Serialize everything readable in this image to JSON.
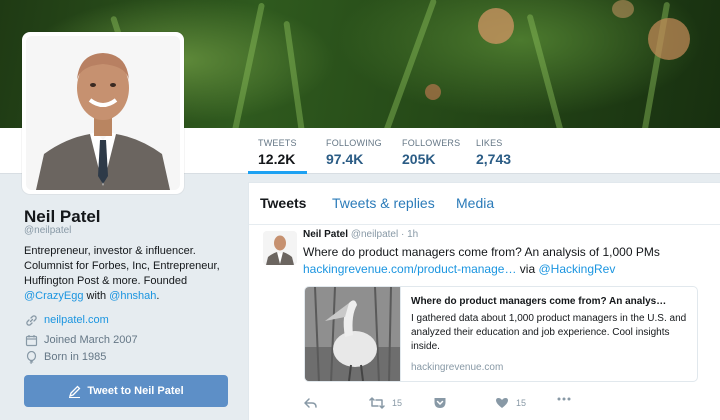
{
  "profile": {
    "name": "Neil Patel",
    "handle": "@neilpatel",
    "bio_text": "Entrepreneur, investor & influencer. Columnist for Forbes, Inc, Entrepreneur, Huffington Post & more. Founded ",
    "bio_mention_1": "@CrazyEgg",
    "bio_with": " with ",
    "bio_mention_2": "@hnshah",
    "bio_end": ".",
    "website": "neilpatel.com",
    "joined": "Joined March 2007",
    "born": "Born in 1985",
    "tweet_to_label": "Tweet to Neil Patel"
  },
  "stats": [
    {
      "label": "TWEETS",
      "value": "12.2K"
    },
    {
      "label": "FOLLOWING",
      "value": "97.4K"
    },
    {
      "label": "FOLLOWERS",
      "value": "205K"
    },
    {
      "label": "LIKES",
      "value": "2,743"
    }
  ],
  "tabs": [
    {
      "label": "Tweets"
    },
    {
      "label": "Tweets & replies"
    },
    {
      "label": "Media"
    }
  ],
  "tweet": {
    "author": "Neil Patel",
    "handle": "@neilpatel",
    "time": "· 1h",
    "text": "Where do product managers come from? An analysis of 1,000 PMs",
    "link": "hackingrevenue.com/product-manage…",
    "via": " via ",
    "via_mention": "@HackingRev",
    "card": {
      "title": "Where do product managers come from? An analys…",
      "description": "I gathered data about 1,000 product managers in the U.S. and analyzed their education and job experience. Cool insights inside.",
      "url": "hackingrevenue.com"
    },
    "retweets": "15",
    "likes": "15"
  },
  "icons": {
    "website": "link-icon",
    "joined": "calendar-icon",
    "born": "balloon-icon",
    "tweet_button": "compose-icon",
    "reply": "reply-icon",
    "retweet": "retweet-icon",
    "pocket": "pocket-icon",
    "like": "heart-icon",
    "more": "more-icon"
  },
  "colors": {
    "accent": "#1da1f2",
    "link": "#1b95e0",
    "button": "#5d8fc7",
    "banner": "#2f5a1e"
  }
}
